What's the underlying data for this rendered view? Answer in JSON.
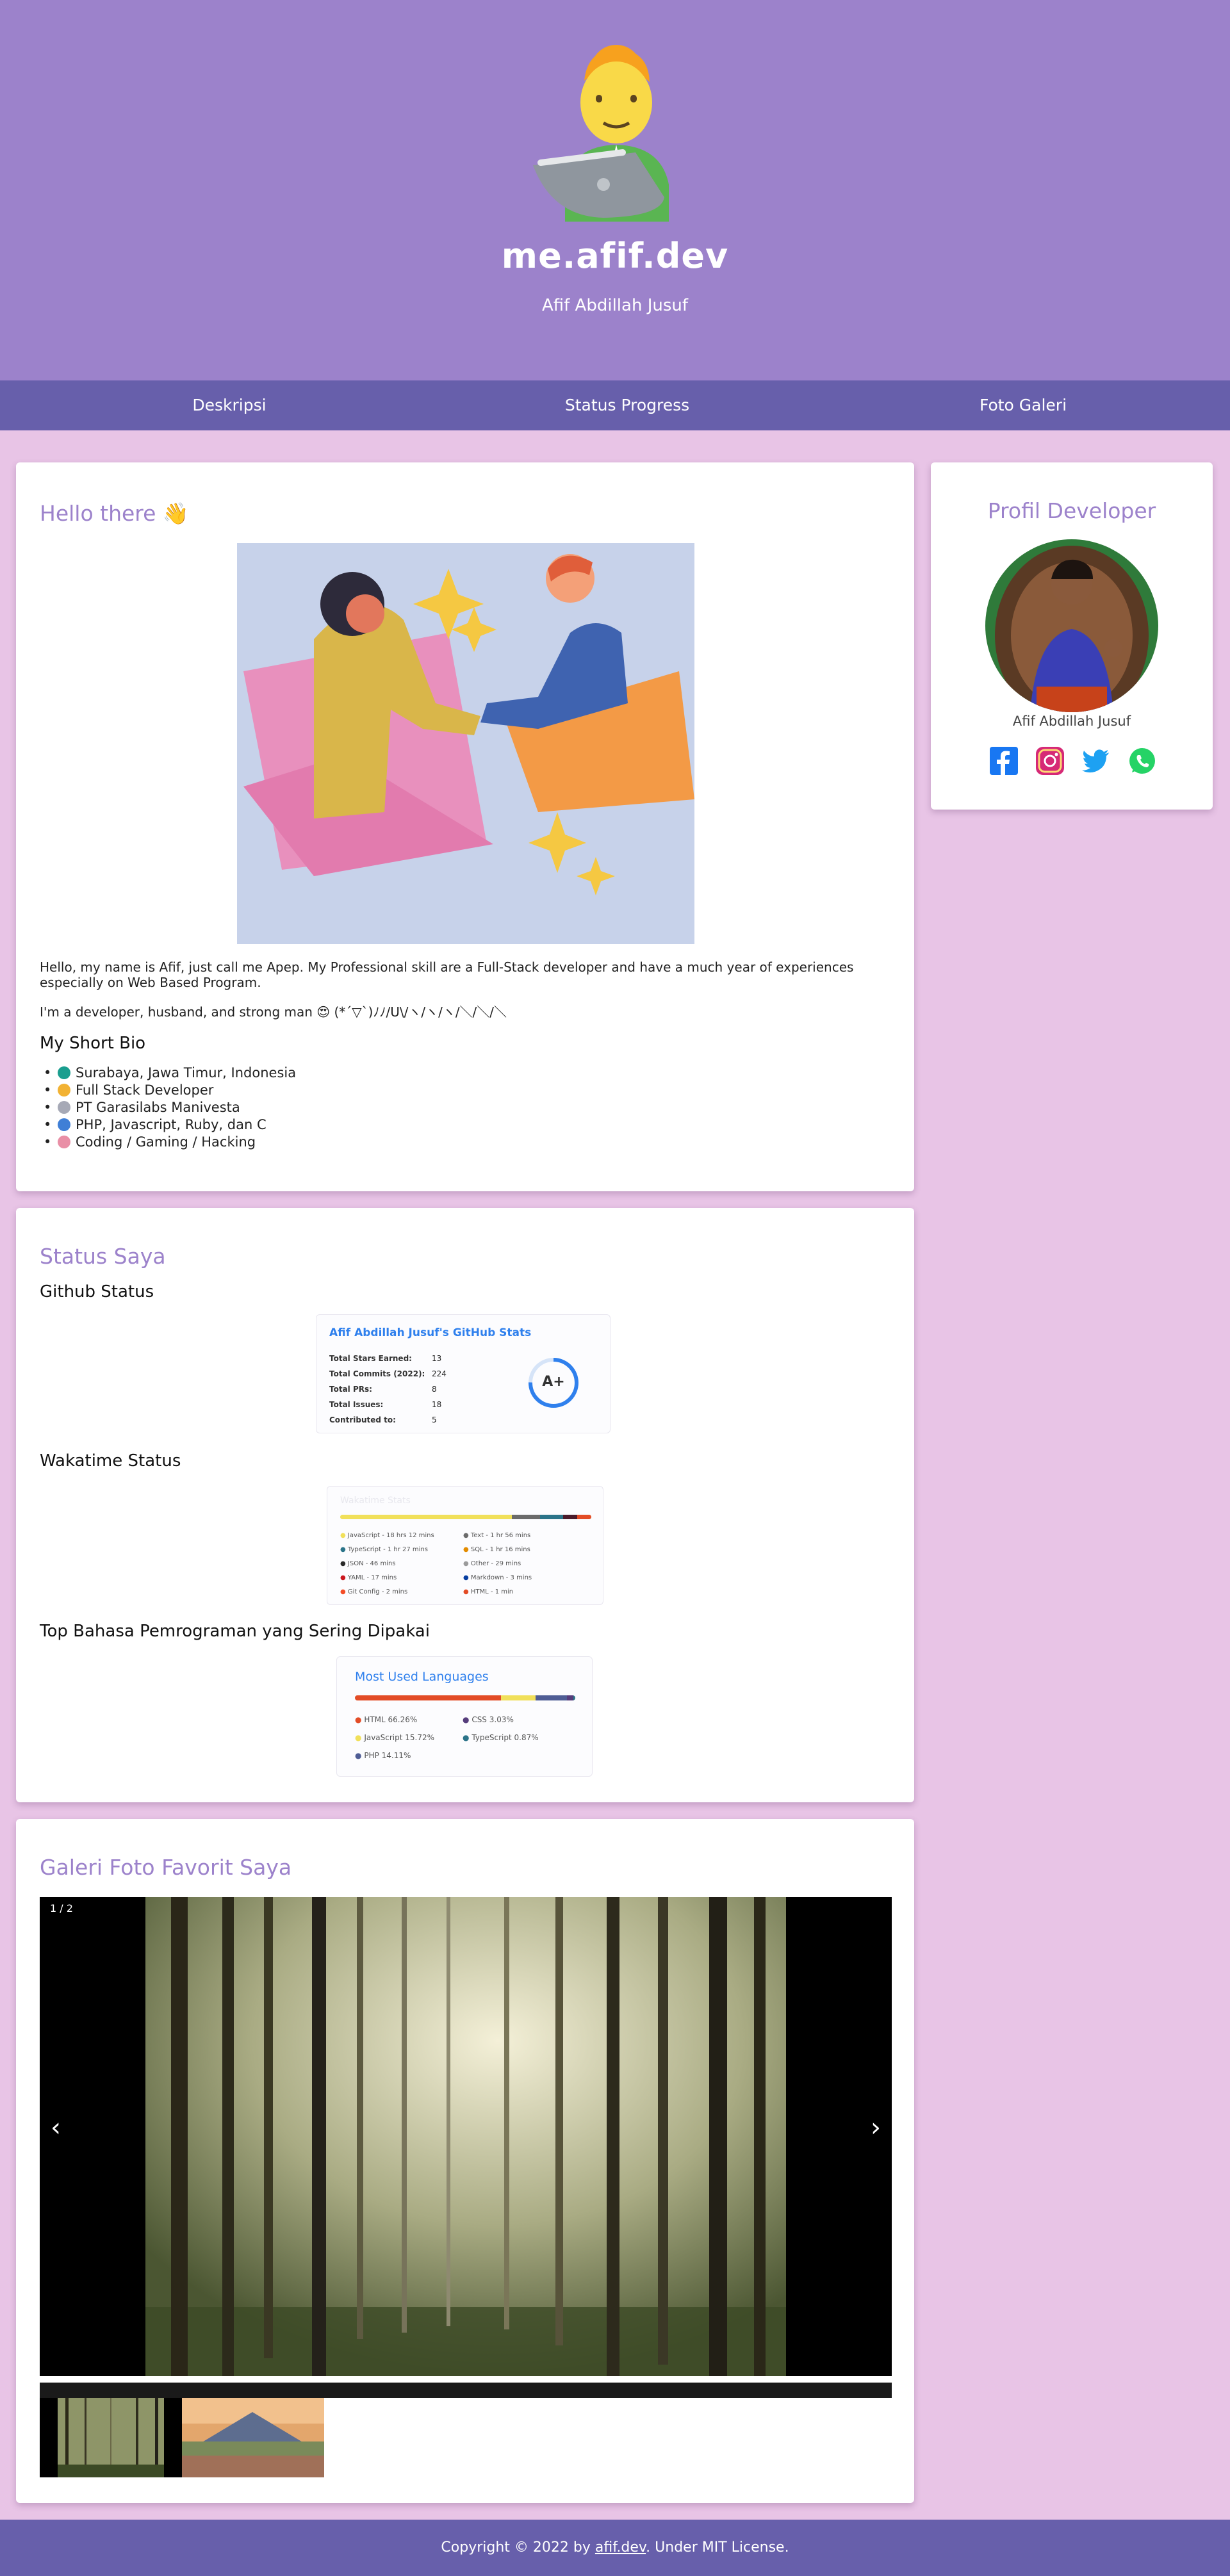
{
  "header": {
    "title": "me.afif.dev",
    "subtitle": "Afif Abdillah Jusuf",
    "avatar_icon": "developer-with-laptop-icon"
  },
  "nav": {
    "items": [
      {
        "label": "Deskripsi"
      },
      {
        "label": "Status Progress"
      },
      {
        "label": "Foto Galeri"
      }
    ]
  },
  "about": {
    "title": "Hello there 👋",
    "intro": "Hello, my name is Afif, just call me Apep. My Professional skill are a Full-Stack developer and have a much year of experiences especially on Web Based Program.",
    "tagline": "I'm a developer, husband, and strong man 😍 (*´▽`)ﾉﾉ/U\\/ヽ/ヽ/ヽ/＼/＼/＼",
    "bio_title": "My Short Bio",
    "bio": [
      {
        "text": "Surabaya, Jawa Timur, Indonesia",
        "icon": "globe-icon",
        "color": "#1a9e8f"
      },
      {
        "text": "Full Stack Developer",
        "icon": "technologist-icon",
        "color": "#f2b233"
      },
      {
        "text": "PT Garasilabs Manivesta",
        "icon": "office-building-icon",
        "color": "#a6a9b6"
      },
      {
        "text": "PHP, Javascript, Ruby, dan C",
        "icon": "books-icon",
        "color": "#3f7fd6"
      },
      {
        "text": "Coding / Gaming / Hacking",
        "icon": "brain-icon",
        "color": "#e98fa6"
      }
    ]
  },
  "status": {
    "title": "Status Saya",
    "github_label": "Github Status",
    "wakatime_label": "Wakatime Status",
    "languages_label": "Top Bahasa Pemrograman yang Sering Dipakai",
    "github_card": {
      "title": "Afif Abdillah Jusuf's GitHub Stats",
      "grade": "A+",
      "rows": [
        {
          "label": "Total Stars Earned:",
          "value": "13"
        },
        {
          "label": "Total Commits (2022):",
          "value": "224"
        },
        {
          "label": "Total PRs:",
          "value": "8"
        },
        {
          "label": "Total Issues:",
          "value": "18"
        },
        {
          "label": "Contributed to:",
          "value": "5"
        }
      ]
    },
    "wakatime_card": {
      "title": "Wakatime Stats",
      "items_left": [
        "JavaScript - 18 hrs 12 mins",
        "TypeScript - 1 hr 27 mins",
        "JSON - 46 mins",
        "YAML - 17 mins",
        "Git Config - 2 mins"
      ],
      "items_right": [
        "Text - 1 hr 56 mins",
        "SQL - 1 hr 16 mins",
        "Other - 29 mins",
        "Markdown - 3 mins",
        "HTML - 1 min"
      ]
    },
    "languages_card": {
      "title": "Most Used Languages",
      "items": [
        {
          "name": "HTML 66.26%",
          "color": "#e34c26",
          "pct": 66.26
        },
        {
          "name": "CSS 3.03%",
          "color": "#563d7c",
          "pct": 3.03
        },
        {
          "name": "JavaScript 15.72%",
          "color": "#f1e05a",
          "pct": 15.72
        },
        {
          "name": "TypeScript 0.87%",
          "color": "#2b7489",
          "pct": 0.87
        },
        {
          "name": "PHP 14.11%",
          "color": "#4f5d95",
          "pct": 14.11
        }
      ]
    }
  },
  "gallery": {
    "title": "Galeri Foto Favorit Saya",
    "counter": "1 / 2",
    "prev": "‹",
    "next": "›"
  },
  "profile": {
    "title": "Profil Developer",
    "name": "Afif Abdillah Jusuf",
    "socials": [
      {
        "icon": "facebook-icon",
        "color": "#1877f2"
      },
      {
        "icon": "instagram-icon",
        "color": "#d62976"
      },
      {
        "icon": "twitter-icon",
        "color": "#1da1f2"
      },
      {
        "icon": "whatsapp-icon",
        "color": "#25d366"
      }
    ]
  },
  "footer": {
    "prefix": "Copyright © 2022 by ",
    "link": "afif.dev",
    "suffix": ". Under MIT License."
  }
}
